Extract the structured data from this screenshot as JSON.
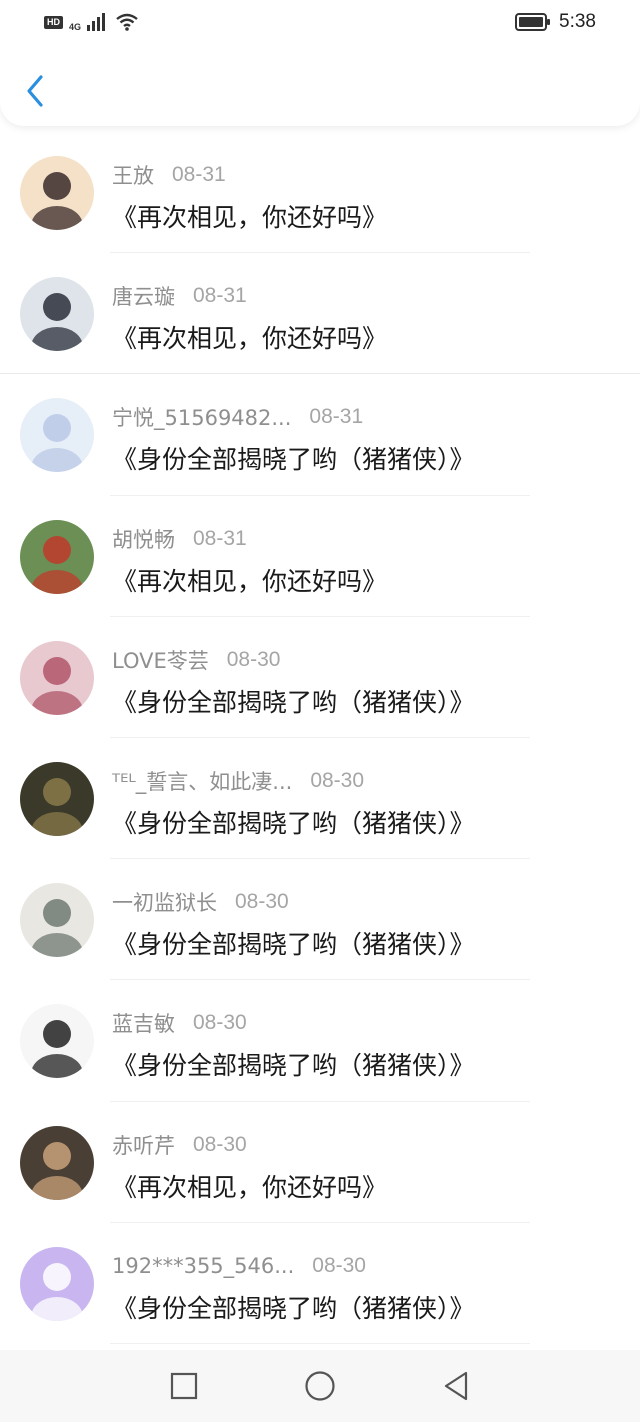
{
  "status_bar": {
    "hd": "HD",
    "network": "4G",
    "time": "5:38",
    "icons": [
      "signal-icon",
      "wifi-icon",
      "battery-icon"
    ]
  },
  "header": {
    "back_icon": "chevron-left-icon",
    "accent": "#2b8fe0"
  },
  "comments": [
    {
      "name": "王放",
      "date": "08-31",
      "title": "《再次相见，你还好吗》",
      "avatar": {
        "bg": "#f4e1c8",
        "fg": "#3a2a2a"
      }
    },
    {
      "name": "唐云璇",
      "date": "08-31",
      "title": "《再次相见，你还好吗》",
      "avatar": {
        "bg": "#dfe3ea",
        "fg": "#2a2f3a"
      }
    },
    {
      "name": "宁悦_51569482...",
      "date": "08-31",
      "title": "《身份全部揭晓了哟（猪猪侠）》",
      "avatar": {
        "bg": "#e6eef8",
        "fg": "#b9c8e6"
      }
    },
    {
      "name": "胡悦畅",
      "date": "08-31",
      "title": "《再次相见，你还好吗》",
      "avatar": {
        "bg": "#6b8f55",
        "fg": "#c03a2b"
      }
    },
    {
      "name": "LOVE苓芸",
      "date": "08-30",
      "title": "《身份全部揭晓了哟（猪猪侠）》",
      "avatar": {
        "bg": "#e8c9cf",
        "fg": "#b0566a"
      }
    },
    {
      "name": "ᵀᴱᴸ_誓言、如此凄...",
      "date": "08-30",
      "title": "《身份全部揭晓了哟（猪猪侠）》",
      "avatar": {
        "bg": "#3b3a2a",
        "fg": "#8a7a4a"
      }
    },
    {
      "name": "一初监狱长",
      "date": "08-30",
      "title": "《身份全部揭晓了哟（猪猪侠）》",
      "avatar": {
        "bg": "#e9e7e2",
        "fg": "#6f7a72"
      }
    },
    {
      "name": "蓝吉敏",
      "date": "08-30",
      "title": "《身份全部揭晓了哟（猪猪侠）》",
      "avatar": {
        "bg": "#f6f6f6",
        "fg": "#222222"
      }
    },
    {
      "name": "赤听芹",
      "date": "08-30",
      "title": "《再次相见，你还好吗》",
      "avatar": {
        "bg": "#4a3f35",
        "fg": "#c9a27a"
      }
    },
    {
      "name": "192***355_546...",
      "date": "08-30",
      "title": "《身份全部揭晓了哟（猪猪侠）》",
      "avatar": {
        "bg": "#c9b6f0",
        "fg": "#ffffff"
      }
    }
  ],
  "nav": {
    "icons": [
      "recent-apps-icon",
      "home-icon",
      "back-triangle-icon"
    ]
  }
}
